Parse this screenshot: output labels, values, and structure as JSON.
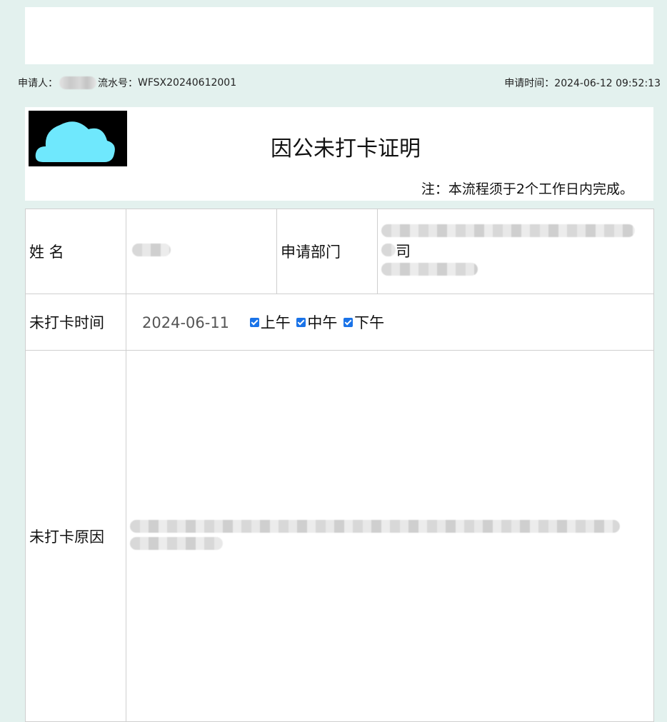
{
  "meta": {
    "applicant_label": "申请人：",
    "serial_label": "流水号：",
    "serial_value": "WFSX20240612001",
    "apply_time_label": "申请时间：",
    "apply_time_value": "2024-06-12 09:52:13"
  },
  "form": {
    "logo_icon": "cloud-icon",
    "title": "因公未打卡证明",
    "note": "注：本流程须于2个工作日内完成。"
  },
  "fields": {
    "name_label": "姓 名",
    "department_label": "申请部门",
    "department_partial_text": "司",
    "missed_time_label": "未打卡时间",
    "missed_date": "2024-06-11",
    "periods": {
      "morning": {
        "label": "上午",
        "checked": true
      },
      "noon": {
        "label": "中午",
        "checked": true
      },
      "afternoon": {
        "label": "下午",
        "checked": true
      }
    },
    "reason_label": "未打卡原因"
  },
  "colors": {
    "page_background": "#e3f1ee",
    "checkbox_accent": "#1a73e8",
    "logo_cloud": "#6fe8fd"
  }
}
